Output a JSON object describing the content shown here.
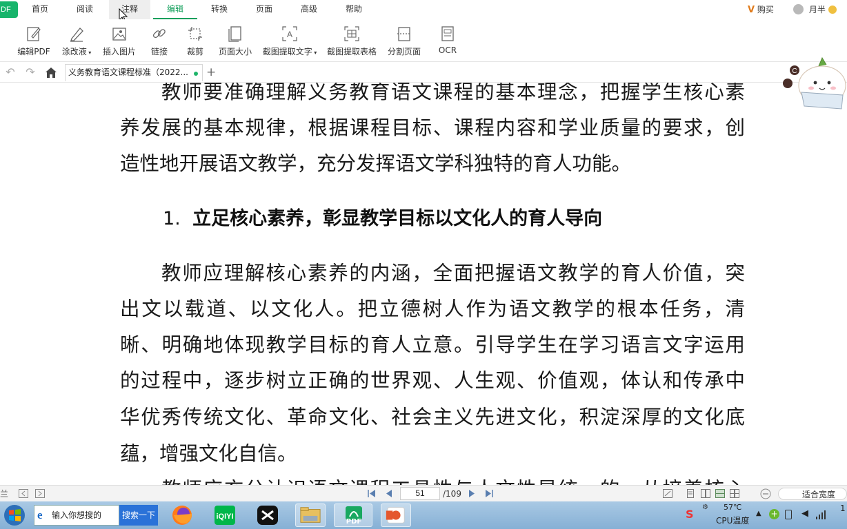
{
  "app": {
    "logo_text": "DF"
  },
  "menubar": {
    "tabs": [
      {
        "label": "首页"
      },
      {
        "label": "阅读"
      },
      {
        "label": "注释"
      },
      {
        "label": "编辑"
      },
      {
        "label": "转换"
      },
      {
        "label": "页面"
      },
      {
        "label": "高级"
      },
      {
        "label": "帮助"
      }
    ],
    "active_tab": "编辑",
    "buy_label": "购买",
    "user_label": "月半",
    "accent_color": "#15a05d"
  },
  "ribbon": {
    "tools": [
      {
        "label": "编辑PDF",
        "icon": "edit-pdf-icon"
      },
      {
        "label": "涂改液",
        "icon": "correction-pen-icon",
        "dropdown": true
      },
      {
        "label": "插入图片",
        "icon": "insert-image-icon"
      },
      {
        "label": "链接",
        "icon": "link-icon"
      },
      {
        "label": "裁剪",
        "icon": "crop-icon"
      },
      {
        "label": "页面大小",
        "icon": "page-size-icon"
      },
      {
        "label": "截图提取文字",
        "icon": "ocr-text-icon",
        "dropdown": true
      },
      {
        "label": "截图提取表格",
        "icon": "extract-table-icon"
      },
      {
        "label": "分割页面",
        "icon": "split-page-icon"
      },
      {
        "label": "OCR",
        "icon": "ocr-icon"
      }
    ]
  },
  "tabbar": {
    "document_tab": "义务教育语文课程标准（2022...",
    "add_tab": "+"
  },
  "document": {
    "lines_top": [
      "教师要准确理解义务教育语文课程的基本理念，把握学生核心素",
      "养发展的基本规律，根据课程目标、课程内容和学业质量的要求，创",
      "造性地开展语文教学，充分发挥语文学科独特的育人功能。"
    ],
    "heading_number": "1.",
    "heading_text": "立足核心素养，彰显教学目标以文化人的育人导向",
    "lines_body": [
      "教师应理解核心素养的内涵，全面把握语文教学的育人价值，突",
      "出文以载道、以文化人。把立德树人作为语文教学的根本任务，清",
      "晰、明确地体现教学目标的育人立意。引导学生在学习语言文字运用",
      "的过程中，逐步树立正确的世界观、人生观、价值观，体认和传承中",
      "华优秀传统文化、革命文化、社会主义先进文化，积淀深厚的文化底",
      "蕴，增强文化自信。"
    ],
    "line_cut": "教师应充分认识语文课程工具性与人文性是统一的，从培养核心"
  },
  "statusbar": {
    "left_label": "兰",
    "current_page": "51",
    "total_pages": "/109",
    "zoom_mode": "适合宽度"
  },
  "taskbar": {
    "search_placeholder": "输入你想搜的",
    "search_button": "搜索一下",
    "pdf_label": "PDF",
    "temperature": "57℃",
    "temperature_label": "CPU温度",
    "clock_partial": "1"
  }
}
